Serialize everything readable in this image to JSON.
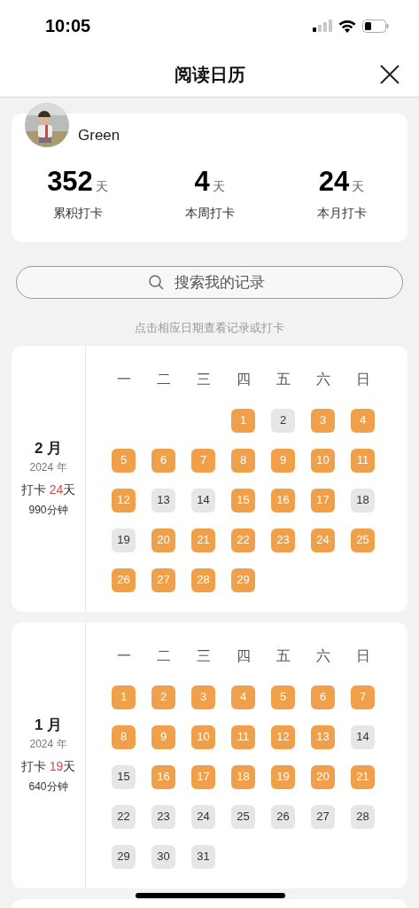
{
  "status_bar": {
    "time": "10:05"
  },
  "header": {
    "title": "阅读日历"
  },
  "profile": {
    "name": "Green",
    "stats": [
      {
        "value": "352",
        "unit": "天",
        "label": "累积打卡"
      },
      {
        "value": "4",
        "unit": "天",
        "label": "本周打卡"
      },
      {
        "value": "24",
        "unit": "天",
        "label": "本月打卡"
      }
    ]
  },
  "search": {
    "placeholder": "搜索我的记录"
  },
  "hint": "点击相应日期查看记录或打卡",
  "months": [
    {
      "month": "2 月",
      "year": "2024 年",
      "checkin_prefix": "打卡",
      "checkin_count": "24",
      "checkin_suffix": "天",
      "minutes": "990分钟",
      "weekdays": [
        "一",
        "二",
        "三",
        "四",
        "五",
        "六",
        "日"
      ],
      "weeks": [
        {
          "right_aligned": true,
          "days": [
            {
              "day": "1",
              "done": true
            },
            {
              "day": "2",
              "done": false
            },
            {
              "day": "3",
              "done": true
            },
            {
              "day": "4",
              "done": true
            }
          ]
        },
        {
          "days": [
            {
              "day": "5",
              "done": true
            },
            {
              "day": "6",
              "done": true
            },
            {
              "day": "7",
              "done": true
            },
            {
              "day": "8",
              "done": true
            },
            {
              "day": "9",
              "done": true
            },
            {
              "day": "10",
              "done": true
            },
            {
              "day": "11",
              "done": true
            }
          ]
        },
        {
          "days": [
            {
              "day": "12",
              "done": true
            },
            {
              "day": "13",
              "done": false
            },
            {
              "day": "14",
              "done": false
            },
            {
              "day": "15",
              "done": true
            },
            {
              "day": "16",
              "done": true
            },
            {
              "day": "17",
              "done": true
            },
            {
              "day": "18",
              "done": false
            }
          ]
        },
        {
          "days": [
            {
              "day": "19",
              "done": false
            },
            {
              "day": "20",
              "done": true
            },
            {
              "day": "21",
              "done": true
            },
            {
              "day": "22",
              "done": true
            },
            {
              "day": "23",
              "done": true
            },
            {
              "day": "24",
              "done": true
            },
            {
              "day": "25",
              "done": true
            }
          ]
        },
        {
          "days": [
            {
              "day": "26",
              "done": true
            },
            {
              "day": "27",
              "done": true
            },
            {
              "day": "28",
              "done": true
            },
            {
              "day": "29",
              "done": true
            }
          ]
        }
      ]
    },
    {
      "month": "1 月",
      "year": "2024 年",
      "checkin_prefix": "打卡",
      "checkin_count": "19",
      "checkin_suffix": "天",
      "minutes": "640分钟",
      "weekdays": [
        "一",
        "二",
        "三",
        "四",
        "五",
        "六",
        "日"
      ],
      "weeks": [
        {
          "days": [
            {
              "day": "1",
              "done": true
            },
            {
              "day": "2",
              "done": true
            },
            {
              "day": "3",
              "done": true
            },
            {
              "day": "4",
              "done": true
            },
            {
              "day": "5",
              "done": true
            },
            {
              "day": "6",
              "done": true
            },
            {
              "day": "7",
              "done": true
            }
          ]
        },
        {
          "days": [
            {
              "day": "8",
              "done": true
            },
            {
              "day": "9",
              "done": true
            },
            {
              "day": "10",
              "done": true
            },
            {
              "day": "11",
              "done": true
            },
            {
              "day": "12",
              "done": true
            },
            {
              "day": "13",
              "done": true
            },
            {
              "day": "14",
              "done": false
            }
          ]
        },
        {
          "days": [
            {
              "day": "15",
              "done": false
            },
            {
              "day": "16",
              "done": true
            },
            {
              "day": "17",
              "done": true
            },
            {
              "day": "18",
              "done": true
            },
            {
              "day": "19",
              "done": true
            },
            {
              "day": "20",
              "done": true
            },
            {
              "day": "21",
              "done": true
            }
          ]
        },
        {
          "days": [
            {
              "day": "22",
              "done": false
            },
            {
              "day": "23",
              "done": false
            },
            {
              "day": "24",
              "done": false
            },
            {
              "day": "25",
              "done": false
            },
            {
              "day": "26",
              "done": false
            },
            {
              "day": "27",
              "done": false
            },
            {
              "day": "28",
              "done": false
            }
          ]
        },
        {
          "days": [
            {
              "day": "29",
              "done": false
            },
            {
              "day": "30",
              "done": false
            },
            {
              "day": "31",
              "done": false
            }
          ]
        }
      ]
    }
  ]
}
